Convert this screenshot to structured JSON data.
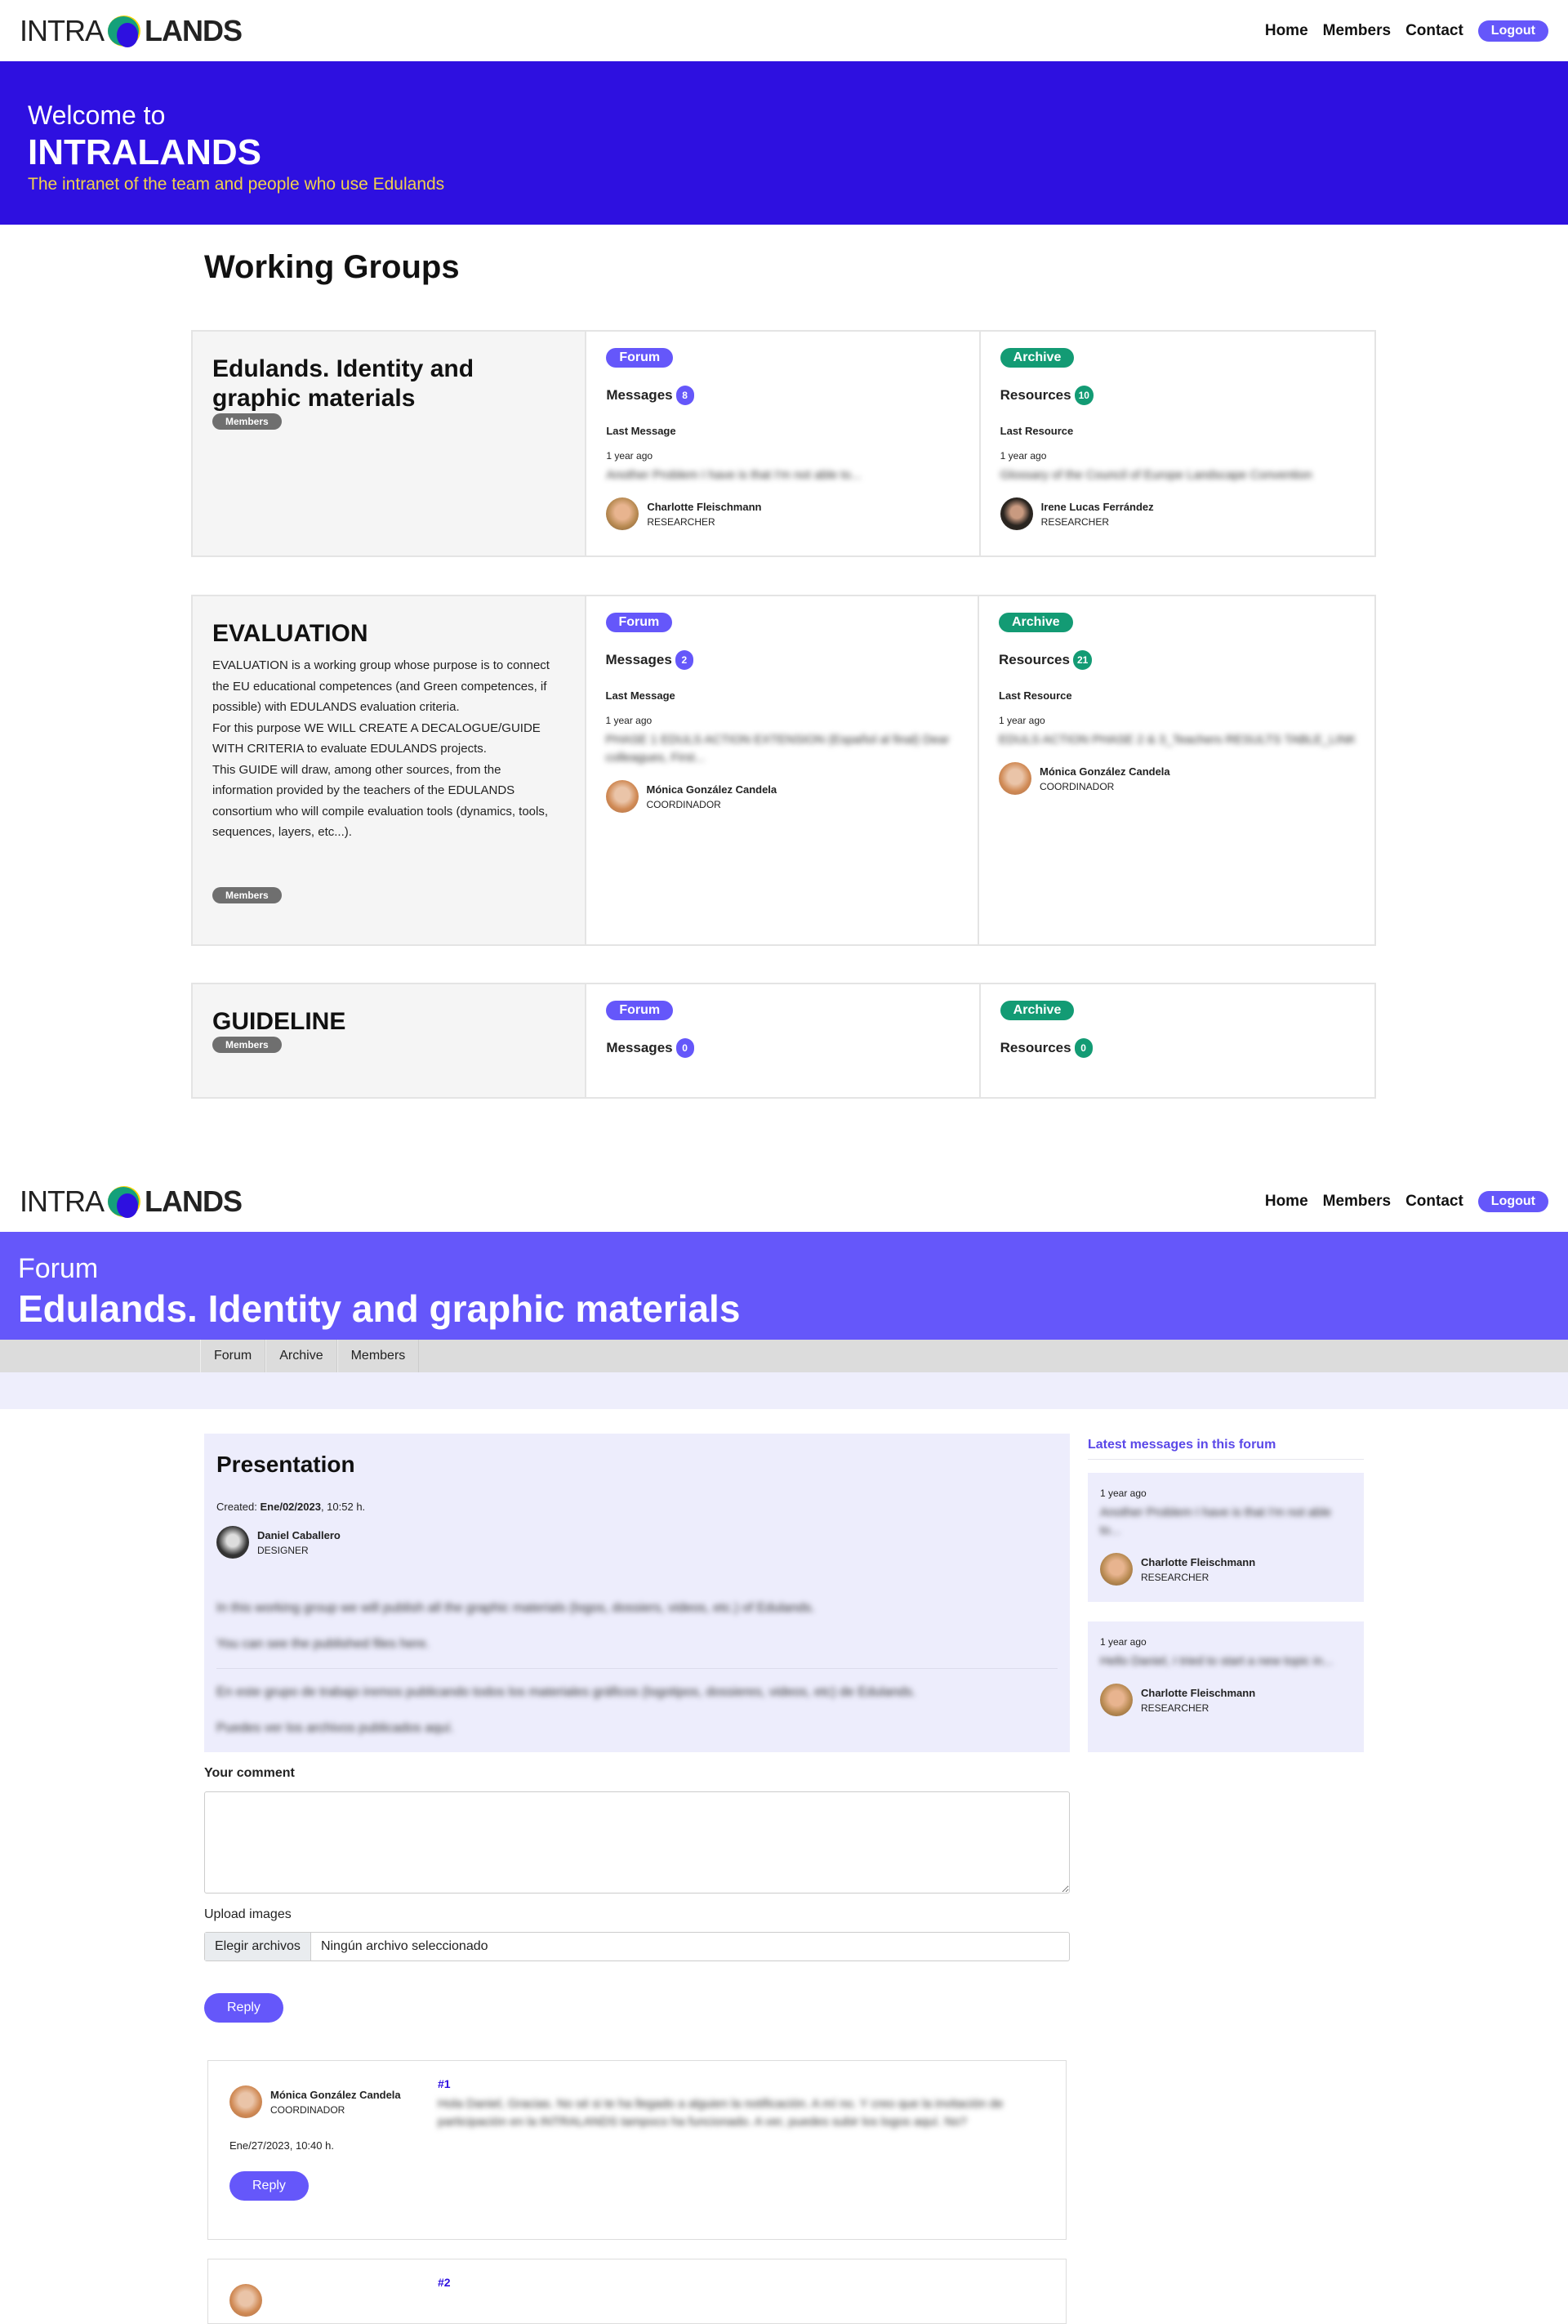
{
  "header": {
    "logo_left": "INTRA",
    "logo_right": "LANDS",
    "nav": [
      "Home",
      "Members",
      "Contact"
    ],
    "logout": "Logout"
  },
  "home": {
    "welcome": "Welcome to",
    "title": "INTRALANDS",
    "subtitle": "The intranet of the team and people who use Edulands",
    "section_title": "Working Groups",
    "groups": [
      {
        "title": "Edulands. Identity and graphic materials",
        "description": "",
        "members_label": "Members",
        "forum_label": "Forum",
        "messages_label": "Messages",
        "messages_count": "8",
        "last_message_label": "Last Message",
        "message_ago": "1 year ago",
        "message_excerpt": "Another Problem I have is that I'm not able to...",
        "message_user": "Charlotte Fleischmann",
        "message_role": "RESEARCHER",
        "archive_label": "Archive",
        "resources_label": "Resources",
        "resources_count": "10",
        "last_resource_label": "Last Resource",
        "resource_ago": "1 year ago",
        "resource_excerpt": "Glossary of the Council of Europe Landscape Convention",
        "resource_user": "Irene Lucas Ferrández",
        "resource_role": "RESEARCHER"
      },
      {
        "title": "EVALUATION",
        "description": [
          "EVALUATION is a working group whose purpose is to connect the EU educational competences (and Green competences, if possible) with EDULANDS evaluation criteria.",
          "For this purpose WE WILL CREATE A DECALOGUE/GUIDE WITH CRITERIA to evaluate EDULANDS projects.",
          "This GUIDE will draw, among other sources, from the information provided by the teachers of the EDULANDS consortium who will compile evaluation tools (dynamics, tools, sequences, layers, etc...)."
        ],
        "members_label": "Members",
        "forum_label": "Forum",
        "messages_label": "Messages",
        "messages_count": "2",
        "last_message_label": "Last Message",
        "message_ago": "1 year ago",
        "message_excerpt": "PHASE 1 EDULS ACTION EXTENSION (Español al final) Dear colleagues, First...",
        "message_user": "Mónica González Candela",
        "message_role": "COORDINADOR",
        "archive_label": "Archive",
        "resources_label": "Resources",
        "resources_count": "21",
        "last_resource_label": "Last Resource",
        "resource_ago": "1 year ago",
        "resource_excerpt": "EDULS ACTION PHASE 2 & 3_Teachers RESULTS TABLE_LINK",
        "resource_user": "Mónica González Candela",
        "resource_role": "COORDINADOR"
      },
      {
        "title": "GUIDELINE",
        "members_label": "Members",
        "forum_label": "Forum",
        "messages_label": "Messages",
        "messages_count": "0",
        "archive_label": "Archive",
        "resources_label": "Resources",
        "resources_count": "0"
      }
    ]
  },
  "forum": {
    "kicker": "Forum",
    "title": "Edulands. Identity and graphic materials",
    "tabs": [
      "Forum",
      "Archive",
      "Members"
    ],
    "post": {
      "title": "Presentation",
      "created_label": "Created:",
      "created_date": "Ene/02/2023",
      "created_time": ", 10:52 h.",
      "author": "Daniel Caballero",
      "role": "DESIGNER",
      "body": [
        "In this working group we will publish all the graphic materials (logos, dossiers, videos, etc.) of Edulands.",
        "You can see the published files here.",
        "En este grupo de trabajo iremos publicando todos los materiales gráficos (logotipos, dossieres, videos, etc) de Edulands.",
        "Puedes ver los archivos publicados aquí."
      ]
    },
    "sidebar": {
      "title": "Latest messages in this forum",
      "items": [
        {
          "ago": "1 year ago",
          "excerpt": "Another Problem I have is that I'm not able to...",
          "user": "Charlotte Fleischmann",
          "role": "RESEARCHER"
        },
        {
          "ago": "1 year ago",
          "excerpt": "Hello Daniel, I tried to start a new topic in...",
          "user": "Charlotte Fleischmann",
          "role": "RESEARCHER"
        }
      ]
    },
    "form": {
      "comment_label": "Your comment",
      "comment_value": "",
      "upload_label": "Upload images",
      "file_button": "Elegir archivos",
      "file_status": "Ningún archivo seleccionado",
      "reply": "Reply"
    },
    "comments": [
      {
        "user": "Mónica González Candela",
        "role": "COORDINADOR",
        "date": "Ene/27/2023, 10:40 h.",
        "number": "#1",
        "body": "Hola Daniel, Gracias. No sé si te ha llegado a alguien la notificación. A mí no. Y creo que la invitación de participación en la INTRALANDS tampoco ha funcionado. A ver, puedes subir los logos aquí. No?",
        "reply": "Reply"
      },
      {
        "number": "#2"
      }
    ]
  },
  "colors": {
    "hero_home": "#2e10e0",
    "hero_forum": "#6557fa",
    "forum_pill": "#6557fa",
    "archive_pill": "#139b74",
    "subtitle": "#f2d24a"
  }
}
